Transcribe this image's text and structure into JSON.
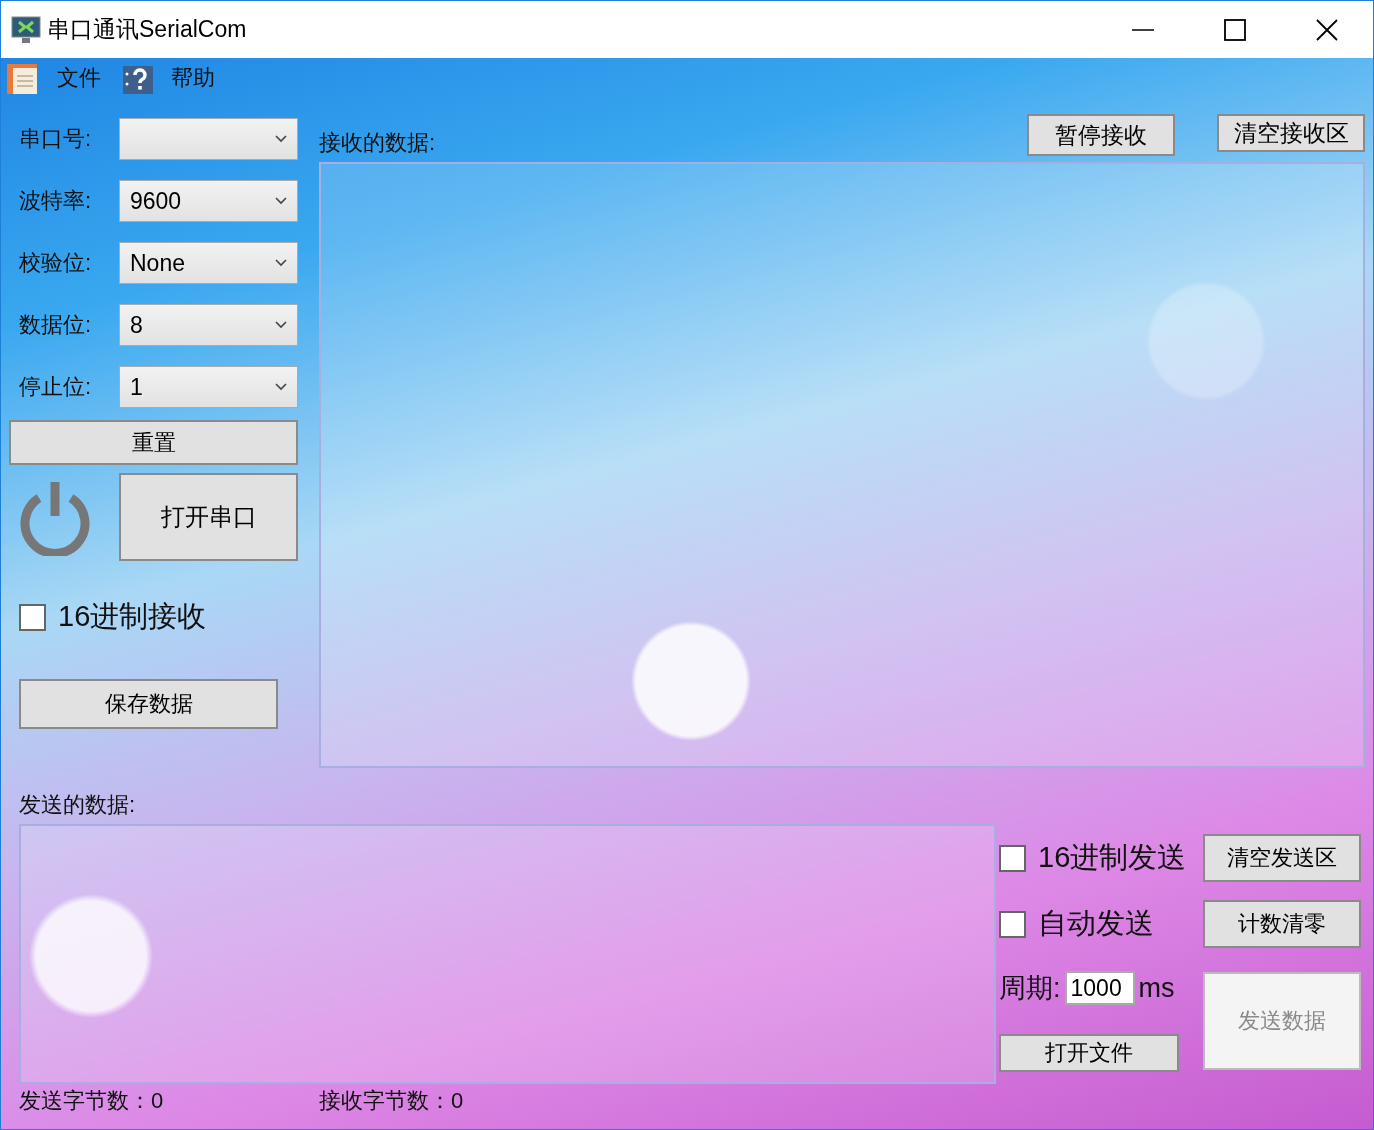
{
  "window": {
    "title": "串口通讯SerialCom"
  },
  "menu": [
    {
      "label": "文件",
      "kind": "document"
    },
    {
      "label": "帮助",
      "kind": "help"
    }
  ],
  "settings": [
    {
      "label": "串口号:"
    },
    {
      "label": "波特率:",
      "value": "9600"
    },
    {
      "label": "校验位:",
      "value": "None"
    },
    {
      "label": "数据位:",
      "value": "8"
    },
    {
      "label": "停止位:",
      "value": "1"
    }
  ],
  "reset_button": "重置",
  "open_port_button": "打开串口",
  "hex_receive": {
    "label": "16进制接收",
    "checked": false
  },
  "save_button": "保存数据",
  "receive": {
    "label": "接收的数据:",
    "pause_button": "暂停接收",
    "clear_button": "清空接收区"
  },
  "send": {
    "label": "发送的数据:"
  },
  "send_options": {
    "hex_send": {
      "label": "16进制发送",
      "checked": false
    },
    "clear_button": "清空发送区",
    "auto_send": {
      "label": "自动发送",
      "checked": false
    },
    "reset_count_button": "计数清零",
    "period_label": "周期:",
    "period_value": "1000",
    "period_unit": "ms",
    "open_file_button": "打开文件",
    "send_button": {
      "label": "发送数据",
      "disabled": true
    }
  },
  "status_bar": [
    {
      "label": "发送字节数：",
      "value": "0"
    },
    {
      "label": "接收字节数：",
      "value": "0"
    }
  ]
}
